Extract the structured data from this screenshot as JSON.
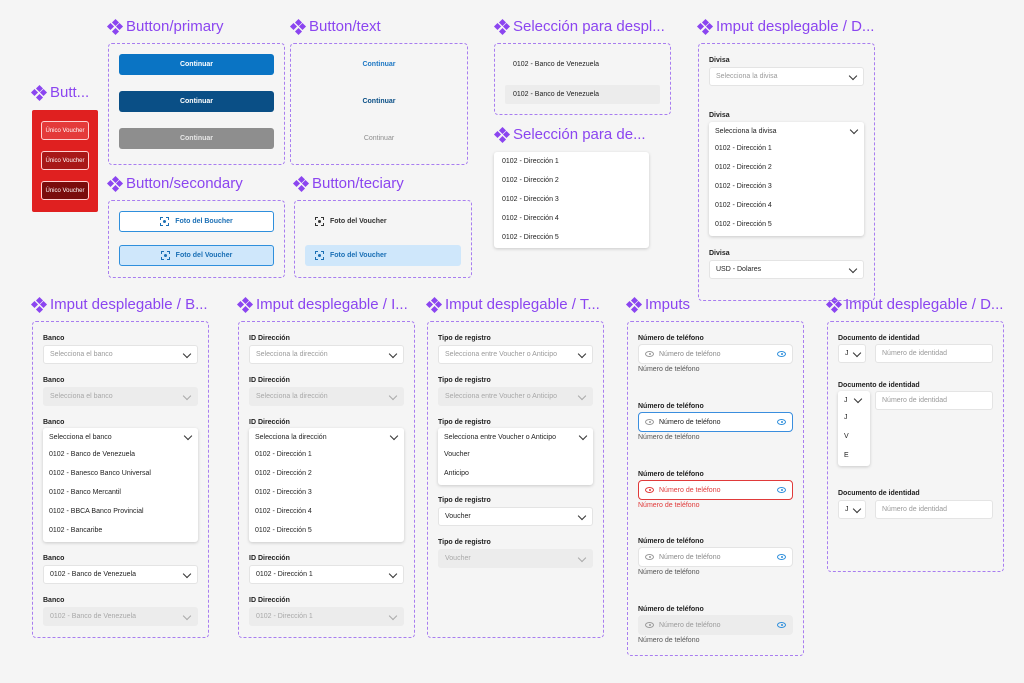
{
  "titles": {
    "red": "Butt...",
    "primary": "Button/primary",
    "text": "Button/text",
    "seleccion1": "Selección para despl...",
    "divisa": "Imput desplegable / D...",
    "secondary": "Button/secondary",
    "teciary": "Button/teciary",
    "seleccion2": "Selección para de...",
    "banco": "Imput desplegable / B...",
    "idDireccion": "Imput desplegable / I...",
    "tipo": "Imput desplegable / T...",
    "imputs": "Imputs",
    "documento": "Imput desplegable / D..."
  },
  "red_buttons": [
    "Único Voucher",
    "Único Voucher",
    "Único Voucher"
  ],
  "primary": [
    "Continuar",
    "Continuar",
    "Continuar"
  ],
  "text_buttons": [
    "Continuar",
    "Continuar",
    "Continuar"
  ],
  "secondary": [
    "Foto del Boucher",
    "Foto del Voucher"
  ],
  "teciary": [
    "Foto del Voucher",
    "Foto del Voucher"
  ],
  "seleccion1": [
    "0102 - Banco de Venezuela",
    "0102 - Banco de Venezuela"
  ],
  "seleccion2": [
    "0102 - Dirección 1",
    "0102 - Dirección 2",
    "0102 - Dirección 3",
    "0102 - Dirección 4",
    "0102 - Dirección 5"
  ],
  "divisa": {
    "label": "Divisa",
    "placeholder": "Selecciona la divisa",
    "options": [
      "0102 - Dirección 1",
      "0102 - Dirección 2",
      "0102 - Dirección 3",
      "0102 - Dirección 4",
      "0102 - Dirección 5"
    ],
    "selected": "USD - Dolares"
  },
  "banco": {
    "label": "Banco",
    "placeholder": "Selecciona el banco",
    "options": [
      "0102 - Banco de Venezuela",
      "0102 - Banesco Banco Universal",
      "0102 - Banco Mercantil",
      "0102 - BBCA Banco Provincial",
      "0102 - Bancaribe"
    ],
    "selected": "0102 - Banco de Venezuela"
  },
  "id_direccion": {
    "label": "ID Dirección",
    "placeholder": "Selecciona la dirección",
    "options": [
      "0102 - Dirección 1",
      "0102 - Dirección 2",
      "0102 - Dirección 3",
      "0102 - Dirección 4",
      "0102 - Dirección 5"
    ],
    "selected": "0102 - Dirección 1"
  },
  "tipo": {
    "label": "Tipo de registro",
    "placeholder": "Selecciona entre Voucher o Anticipo",
    "options": [
      "Voucher",
      "Anticipo"
    ],
    "selected": "Voucher"
  },
  "phone": {
    "label": "Número de teléfono",
    "placeholder": "Número de teléfono",
    "helper": "Número de teléfono"
  },
  "documento": {
    "label": "Documento de identidad",
    "type": "J",
    "placeholder": "Número de identidad",
    "options": [
      "J",
      "V",
      "E"
    ]
  }
}
